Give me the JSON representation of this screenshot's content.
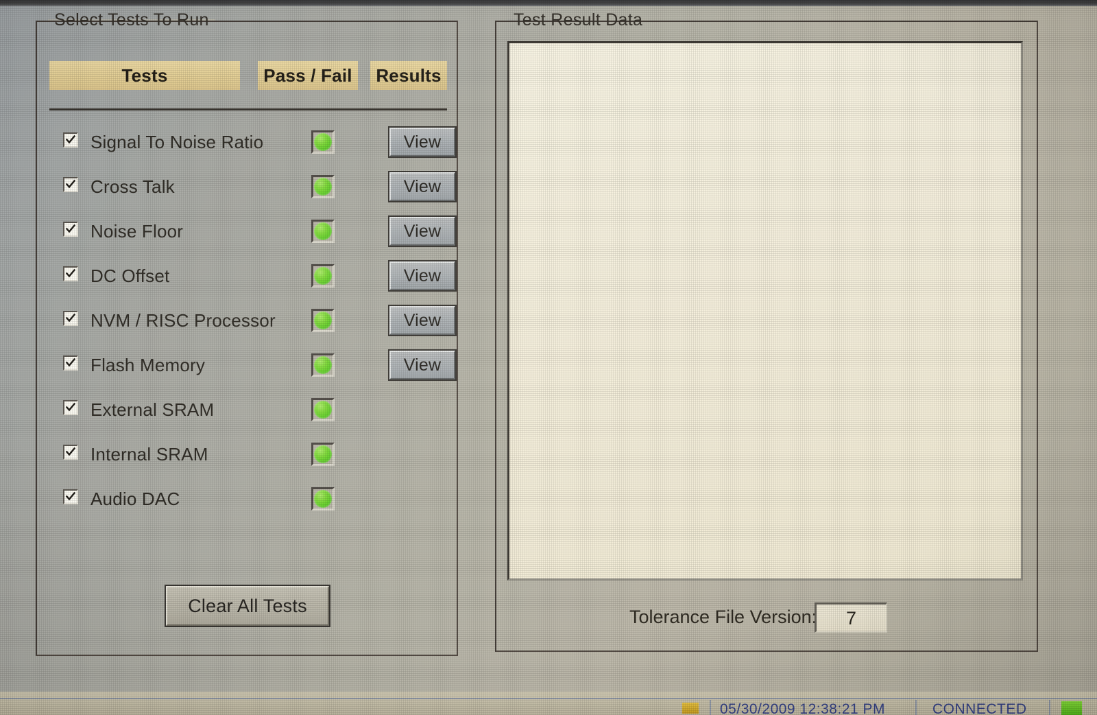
{
  "groups": {
    "tests": {
      "title": "Select Tests To Run"
    },
    "results": {
      "title": "Test Result Data"
    }
  },
  "columns": {
    "tests": "Tests",
    "pass_fail": "Pass / Fail",
    "results": "Results"
  },
  "tests": [
    {
      "label": "Signal To Noise Ratio",
      "checked": true,
      "status": "pass",
      "view_label": "View",
      "has_view": true
    },
    {
      "label": "Cross Talk",
      "checked": true,
      "status": "pass",
      "view_label": "View",
      "has_view": true
    },
    {
      "label": "Noise Floor",
      "checked": true,
      "status": "pass",
      "view_label": "View",
      "has_view": true
    },
    {
      "label": "DC Offset",
      "checked": true,
      "status": "pass",
      "view_label": "View",
      "has_view": true
    },
    {
      "label": "NVM / RISC Processor",
      "checked": true,
      "status": "pass",
      "view_label": "View",
      "has_view": true
    },
    {
      "label": "Flash Memory",
      "checked": true,
      "status": "pass",
      "view_label": "View",
      "has_view": true
    },
    {
      "label": "External SRAM",
      "checked": true,
      "status": "pass",
      "view_label": "",
      "has_view": false
    },
    {
      "label": "Internal SRAM",
      "checked": true,
      "status": "pass",
      "view_label": "",
      "has_view": false
    },
    {
      "label": "Audio DAC",
      "checked": true,
      "status": "pass",
      "view_label": "",
      "has_view": false
    }
  ],
  "buttons": {
    "clear_all_tests": "Clear All Tests"
  },
  "result_data": {
    "text": ""
  },
  "tolerance": {
    "label": "Tolerance File Version:",
    "value": "7"
  },
  "taskbar": {
    "buttons_text": "",
    "datetime": "05/30/2009 12:38:21 PM",
    "status": "CONNECTED"
  },
  "colors": {
    "dialog_face": "#b2b1a7",
    "header_bar": "#e2cd93",
    "led_pass": "#58cc21",
    "textarea_bg": "#f3eedd",
    "taskbar_text": "#2b3a86",
    "group_border": "#3a3330"
  }
}
